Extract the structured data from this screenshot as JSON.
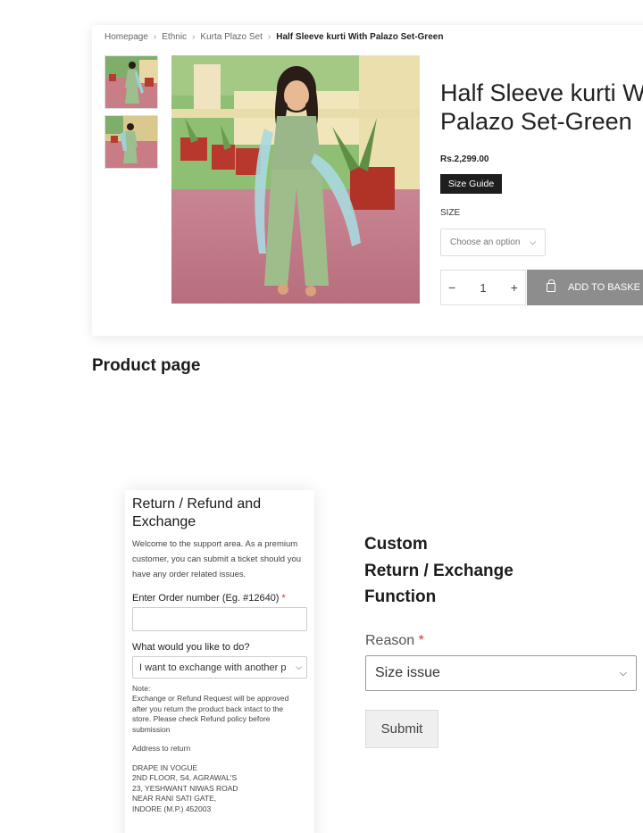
{
  "product": {
    "breadcrumb": {
      "items": [
        "Homepage",
        "Ethnic",
        "Kurta Plazo Set"
      ],
      "current": "Half Sleeve kurti With Palazo Set-Green",
      "separator": ">"
    },
    "title_line1": "Half Sleeve kurti W",
    "title_line2": "Palazo Set-Green",
    "price": "Rs.2,299.00",
    "size_guide_label": "Size Guide",
    "size_label": "SIZE",
    "size_select_value": "Choose an option",
    "quantity": "1",
    "qty_minus": "−",
    "qty_plus": "+",
    "add_to_basket_label": "ADD TO BASKE",
    "colors": {
      "basket_button": "#8d8d8d",
      "size_guide_bg": "#1e1e1e"
    }
  },
  "captions": {
    "product_page": "Product page",
    "custom_line1": "Custom",
    "custom_line2": "Return / Exchange",
    "custom_line3": "Function"
  },
  "return_form": {
    "title": "Return / Refund and Exchange",
    "intro": "Welcome to the support area. As a premium customer, you can submit a ticket should you have any order related issues.",
    "order_label": "Enter Order number (Eg. #12640)",
    "order_value": "",
    "required_mark": "*",
    "action_label": "What would you like to do?",
    "action_value": "I want to exchange with another p",
    "note_lines": [
      "Note:",
      "Exchange or Refund Request will be approved",
      "after you return the product back intact to the",
      "store. Please check Refund policy before",
      "submission"
    ],
    "address_heading": "Address to return",
    "address_lines": [
      "DRAPE IN VOGUE",
      "2ND FLOOR, S4, AGRAWAL'S",
      "23, YESHWANT NIWAS ROAD",
      "NEAR RANI SATI GATE,",
      "INDORE (M.P.) 452003"
    ]
  },
  "reason_form": {
    "label": "Reason",
    "required_mark": "*",
    "select_value": "Size issue",
    "submit_label": "Submit"
  }
}
